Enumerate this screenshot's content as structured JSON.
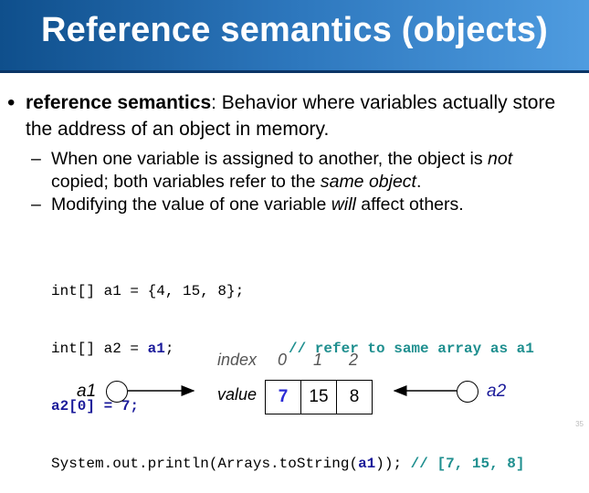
{
  "slide": {
    "title": "Reference semantics (objects)",
    "bullet": {
      "term": "reference semantics",
      "text": ": Behavior where variables actually store the address of an object in memory."
    },
    "subbullets": [
      {
        "pre": "When one variable is assigned to another, the object is ",
        "em1": "not",
        "mid": " copied; both variables refer to the ",
        "em2": "same object",
        "post": "."
      },
      {
        "pre": "Modifying the value of one variable ",
        "em1": "will",
        "post": " affect others."
      }
    ],
    "code": {
      "line1": "int[] a1 = {4, 15, 8};",
      "line2_pre": "int[] a2 = ",
      "line2_kw": "a1",
      "line2_post": ";",
      "line2_comment": "// refer to same array as a1",
      "line3": "a2[0] = 7;",
      "line4_pre": "System.out.println(Arrays.toString(",
      "line4_kw": "a1",
      "line4_post": ")); ",
      "line4_comment": "// [7, 15, 8]"
    },
    "diagram": {
      "index_label": "index",
      "indices": [
        "0",
        "1",
        "2"
      ],
      "value_label": "value",
      "values": [
        "7",
        "15",
        "8"
      ],
      "var_left": "a1",
      "var_right": "a2"
    },
    "page_number": "35"
  }
}
